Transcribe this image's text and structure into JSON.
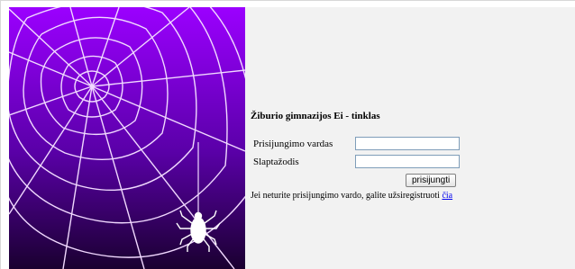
{
  "colors": {
    "gradient_top": "#9b00ff",
    "gradient_bottom": "#1a0030",
    "web_color": "#f1d9ff",
    "spider_color": "#ffffff",
    "link_color": "#0000ee"
  },
  "decoration": {
    "image": "spider-web-with-spider",
    "icon": "spider-icon"
  },
  "form": {
    "title": "Žiburio gimnazijos Ei - tinklas",
    "username_label": "Prisijungimo vardas",
    "username_value": "",
    "password_label": "Slaptažodis",
    "password_value": "",
    "submit_label": "prisijungti"
  },
  "register": {
    "text": "Jei neturite prisijungimo vardo, galite užsiregistruoti ",
    "link_text": "čia"
  }
}
